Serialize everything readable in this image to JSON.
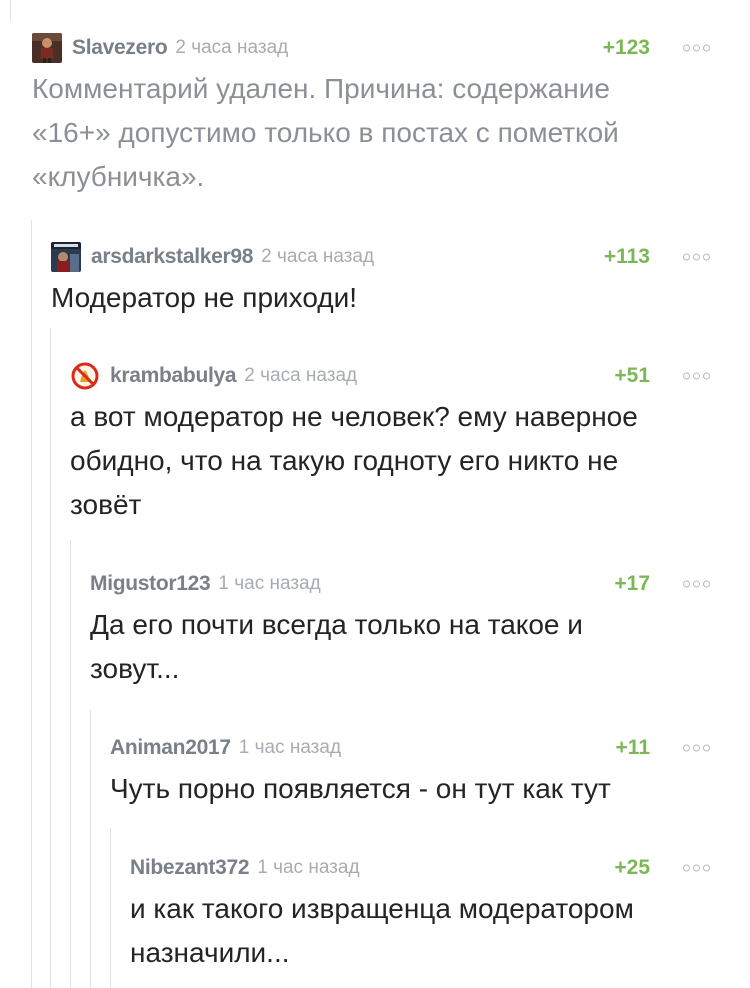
{
  "colors": {
    "rating_positive": "#7cb756",
    "username": "#7a8088",
    "time": "#a7acb2",
    "text": "#222426",
    "deleted_text": "#8b9096",
    "thread_line": "#e3e3e3"
  },
  "comments": [
    {
      "username": "Slavezero",
      "time": "2 часа назад",
      "rating": "+123",
      "text": "Комментарий удален. Причина: содержание «16+» допустимо только в постах с пометкой «клубничка».",
      "deleted": true,
      "avatar": "user-avatar"
    },
    {
      "username": "arsdarkstalker98",
      "time": "2 часа назад",
      "rating": "+113",
      "text": "Модератор не приходи!",
      "avatar": "user-avatar"
    },
    {
      "username": "krambabulya",
      "time": "2 часа назад",
      "rating": "+51",
      "text": "а вот модератор не человек? ему наверное обидно, что на такую годноту его никто не зовёт",
      "avatar": "no-sign-avatar"
    },
    {
      "username": "Migustor123",
      "time": "1 час назад",
      "rating": "+17",
      "text": "Да его почти всегда только на такое и зовут..."
    },
    {
      "username": "Animan2017",
      "time": "1 час назад",
      "rating": "+11",
      "text": "Чуть порно появляется - он тут как тут"
    },
    {
      "username": "Nibezant372",
      "time": "1 час назад",
      "rating": "+25",
      "text": "и как такого извращенца модератором назначили..."
    }
  ]
}
